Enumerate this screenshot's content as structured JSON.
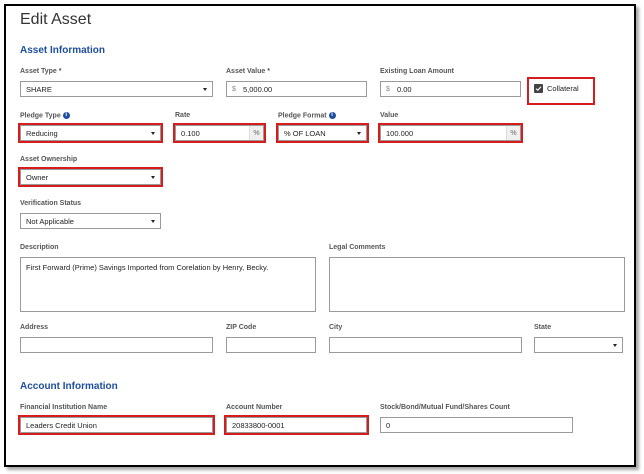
{
  "page_title": "Edit Asset",
  "asset_info": {
    "section_title": "Asset Information",
    "asset_type": {
      "label": "Asset Type *",
      "value": "SHARE"
    },
    "asset_value": {
      "label": "Asset Value *",
      "prefix": "$",
      "value": "5,000.00"
    },
    "existing_loan": {
      "label": "Existing Loan Amount",
      "prefix": "$",
      "value": "0.00"
    },
    "collateral": {
      "label": "Collateral",
      "checked": true
    },
    "pledge_type": {
      "label": "Pledge Type",
      "value": "Reducing"
    },
    "rate": {
      "label": "Rate",
      "value": "0.100",
      "suffix": "%"
    },
    "pledge_format": {
      "label": "Pledge Format",
      "value": "% OF LOAN"
    },
    "value": {
      "label": "Value",
      "value": "100.000",
      "suffix": "%"
    },
    "asset_ownership": {
      "label": "Asset Ownership",
      "value": "Owner"
    },
    "verification_status": {
      "label": "Verification Status",
      "value": "Not Applicable"
    },
    "description": {
      "label": "Description",
      "value": "First Forward (Prime) Savings Imported from Corelation by Henry, Becky."
    },
    "legal_comments": {
      "label": "Legal Comments",
      "value": ""
    },
    "address": {
      "label": "Address",
      "value": ""
    },
    "zip": {
      "label": "ZIP Code",
      "value": ""
    },
    "city": {
      "label": "City",
      "value": ""
    },
    "state": {
      "label": "State",
      "value": ""
    }
  },
  "account_info": {
    "section_title": "Account Information",
    "institution": {
      "label": "Financial Institution Name",
      "value": "Leaders Credit Union"
    },
    "account_number": {
      "label": "Account Number",
      "value": "20833800-0001"
    },
    "shares_count": {
      "label": "Stock/Bond/Mutual Fund/Shares Count",
      "value": "0"
    }
  },
  "colors": {
    "accent": "#1f4e9c",
    "highlight": "#d61d1d"
  }
}
